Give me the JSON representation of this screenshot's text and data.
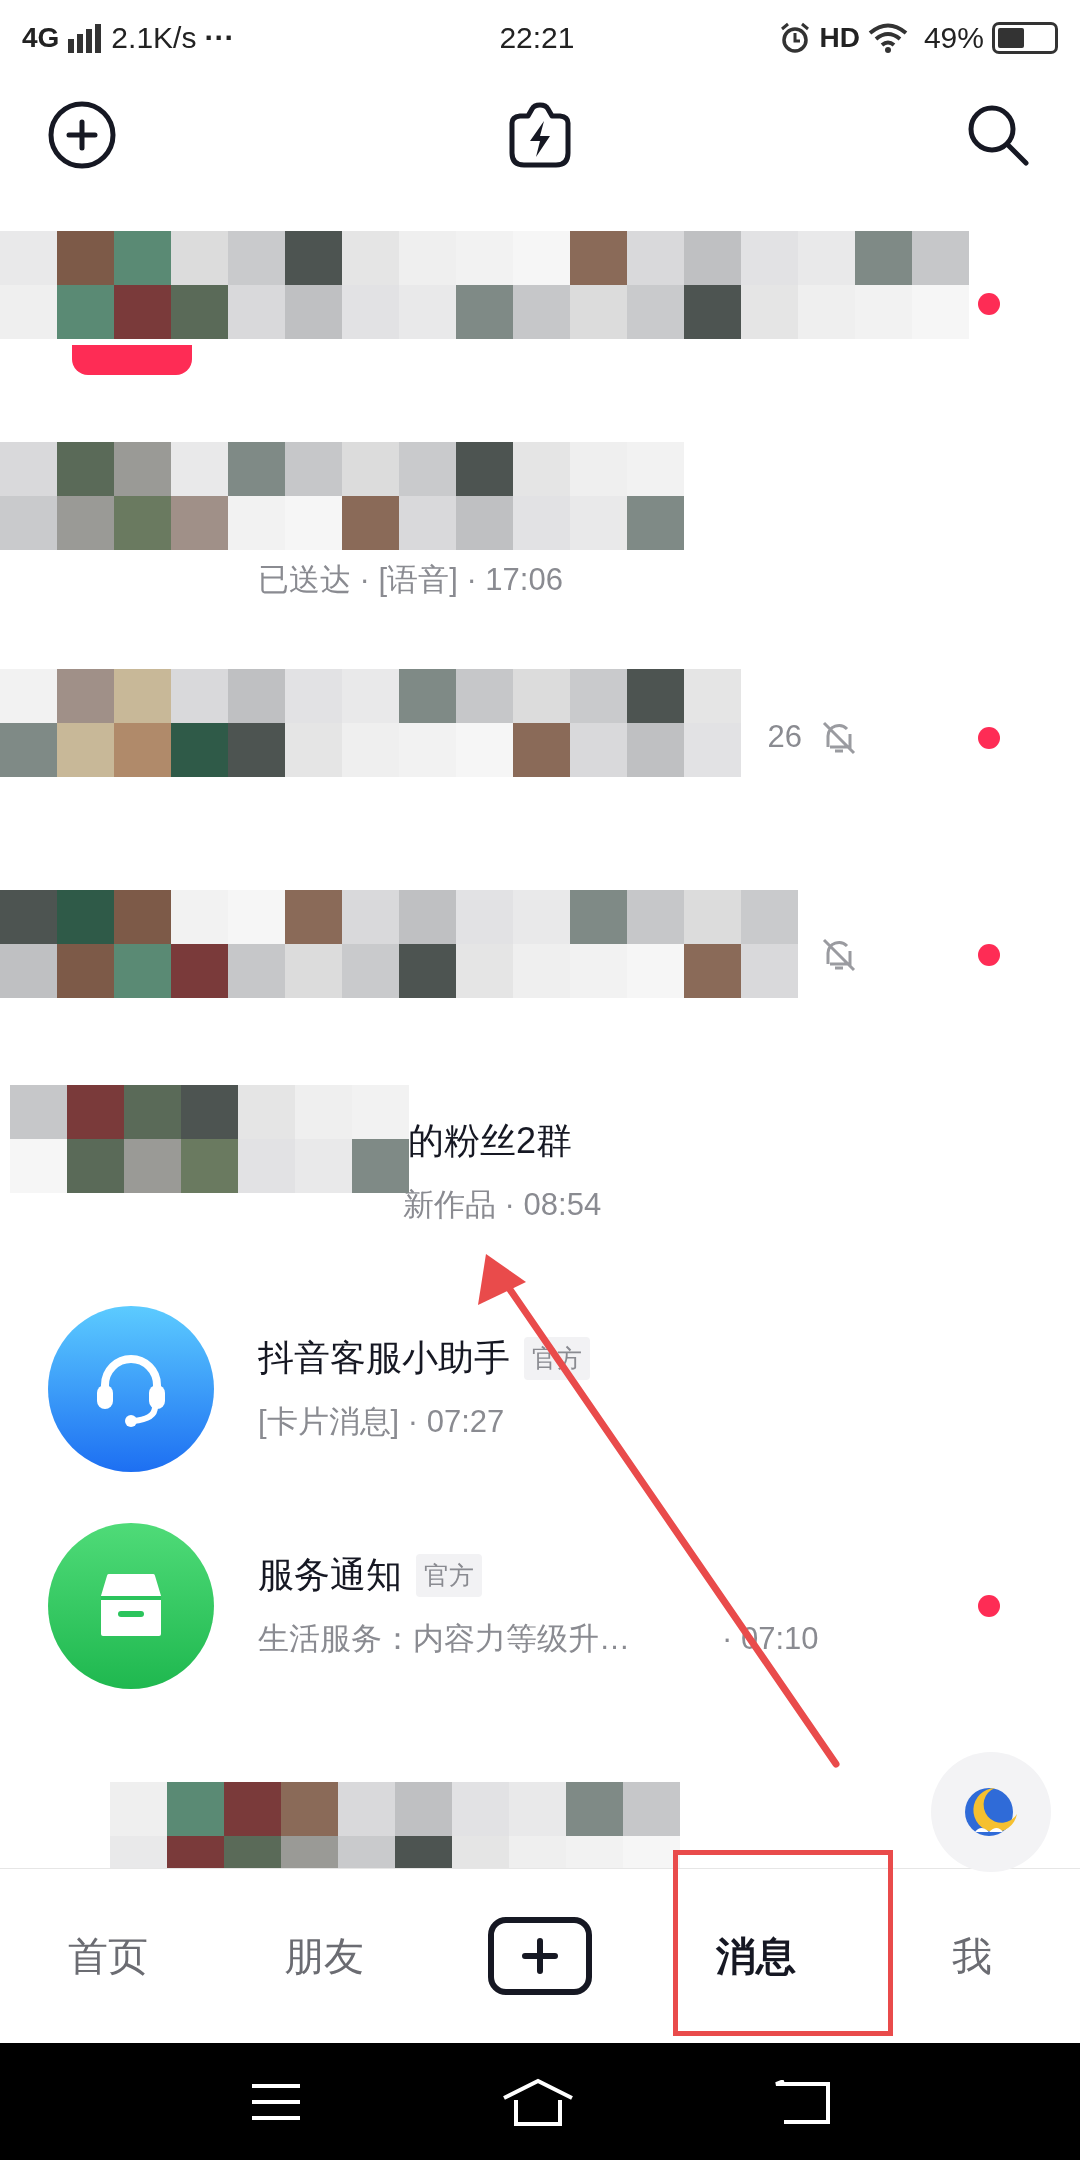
{
  "status_bar": {
    "network": "4G",
    "speed": "2.1K/s",
    "more": "···",
    "time": "22:21",
    "hd": "HD",
    "battery_text": "49%"
  },
  "rows": [
    {
      "kind": "redacted",
      "live": true,
      "unread": true,
      "muted": false
    },
    {
      "kind": "redacted",
      "preview": "已送达 · [语音] · 17:06",
      "unread": false,
      "muted": false
    },
    {
      "kind": "redacted",
      "preview": "26",
      "unread": true,
      "muted": true
    },
    {
      "kind": "redacted",
      "unread": true,
      "muted": true
    },
    {
      "kind": "redacted",
      "title": "的粉丝2群",
      "preview": "新作品 · 08:54",
      "unread": false,
      "muted": false
    },
    {
      "kind": "assistant",
      "title": "抖音客服小助手",
      "tag": "官方",
      "preview": "[卡片消息] · 07:27",
      "unread": false,
      "muted": false
    },
    {
      "kind": "notice",
      "title": "服务通知",
      "tag": "官方",
      "preview": "生活服务：内容力等级升…",
      "time": "· 07:10",
      "unread": true,
      "muted": false
    },
    {
      "kind": "redacted",
      "unread": false,
      "muted": false
    }
  ],
  "bottom_nav": [
    {
      "kind": "text",
      "label": "首页",
      "selected": false
    },
    {
      "kind": "text",
      "label": "朋友",
      "selected": false
    },
    {
      "kind": "create",
      "selected": false
    },
    {
      "kind": "text",
      "label": "消息",
      "selected": true
    },
    {
      "kind": "text",
      "label": "我",
      "selected": false
    }
  ]
}
